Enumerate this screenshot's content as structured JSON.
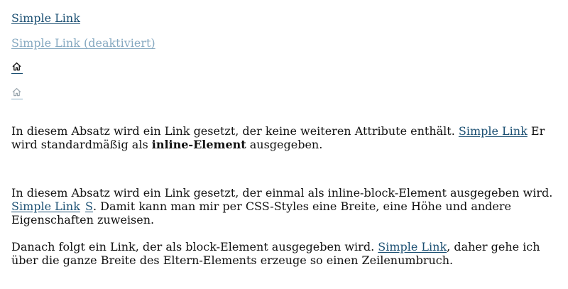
{
  "links": {
    "simple": "Simple Link",
    "simple_disabled": "Simple Link (deaktiviert)",
    "home_icon": "home-icon",
    "home_icon_disabled": "home-icon"
  },
  "para1": {
    "before": "In diesem Absatz wird ein Link gesetzt, der keine weiteren Attribute enthält.",
    "link": "Simple Link",
    "after_a": " Er wird standardmäßig als ",
    "bold": "inline-Element",
    "after_b": " ausgegeben."
  },
  "para2": {
    "before": "In diesem Absatz wird ein Link gesetzt, der einmal als inline-block-Element ausgegeben wird.",
    "link1": "Simple Link",
    "link2": "S",
    "after": ". Damit kann man mir per CSS-Styles eine Breite, eine Höhe und andere Eigenschaften zuweisen."
  },
  "para3": {
    "before": "Danach folgt ein Link, der als block-Element ausgegeben wird.",
    "link": "Simple Link",
    "after": ", daher gehe ich über die ganze Breite des Eltern-Elements erzeuge so einen Zeilenumbruch."
  },
  "colors": {
    "link": "#1b4f72",
    "link_disabled": "#86a9c1",
    "text": "#111111",
    "background": "#ffffff"
  }
}
